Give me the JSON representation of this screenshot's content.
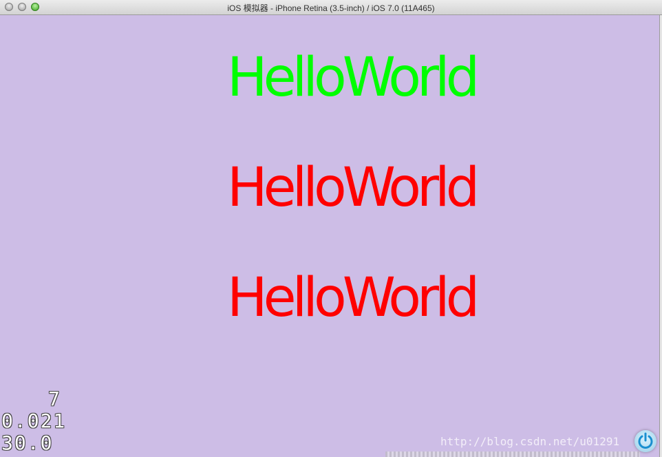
{
  "window": {
    "title": "iOS 模拟器 - iPhone Retina (3.5-inch) / iOS 7.0 (11A465)"
  },
  "labels": [
    {
      "text": "HelloWorld",
      "color": "#00ff00"
    },
    {
      "text": "HelloWorld",
      "color": "#ff0000"
    },
    {
      "text": "HelloWorld",
      "color": "#ff0000"
    }
  ],
  "stats": {
    "draw_calls": "7",
    "frame_time": "0.021",
    "fps": "30.0"
  },
  "watermark": "http://blog.csdn.net/u01291",
  "colors": {
    "background": "#cdbde6",
    "stat_text": "#ffffff"
  },
  "icons": {
    "power": "power-icon"
  }
}
